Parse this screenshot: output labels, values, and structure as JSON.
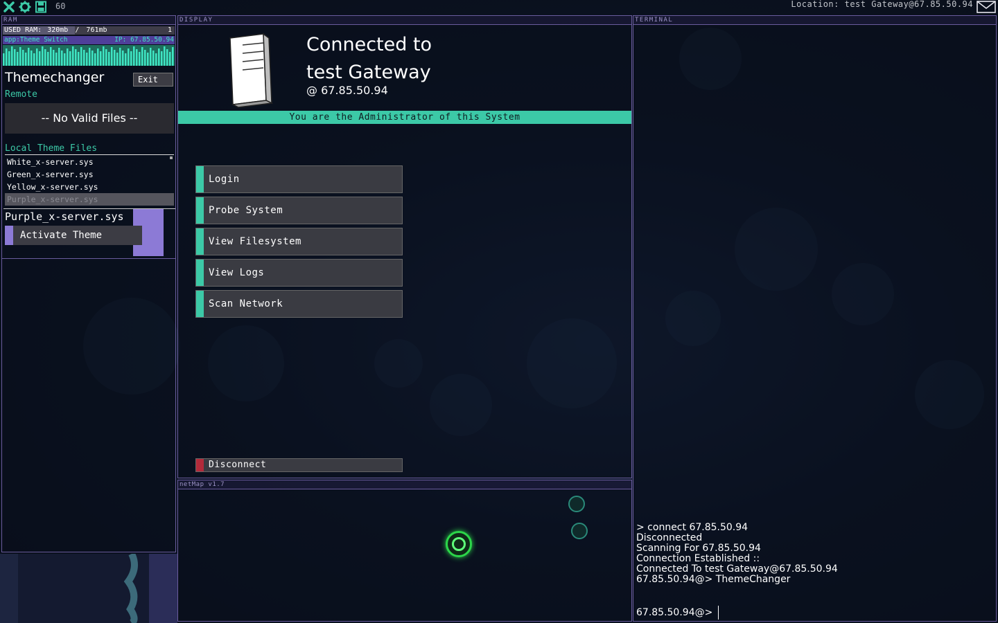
{
  "topbar": {
    "icons": [
      "close-icon",
      "gear-icon",
      "save-icon"
    ],
    "fps": "60",
    "location": "Location: test Gateway@67.85.50.94",
    "mail_icon": "mail-icon"
  },
  "ram": {
    "header": "RAM",
    "used_label": "USED RAM:",
    "used_value": "320mb",
    "total": "761mb",
    "separator": "/",
    "count": "1",
    "used_fraction": 0.42,
    "app_label": "app:Theme Switch",
    "app_ip": "IP: 67.85.50.94"
  },
  "themechanger": {
    "title": "Themechanger",
    "exit_label": "Exit",
    "remote_label": "Remote",
    "no_files": "-- No Valid Files --",
    "local_label": "Local Theme Files",
    "files": [
      "White_x-server.sys",
      "Green_x-server.sys",
      "Yellow_x-server.sys",
      "Purple_x-server.sys"
    ],
    "selected_file": "Purple_x-server.sys",
    "activate_label": "Activate Theme",
    "swatch_color": "#8c7ad6"
  },
  "display": {
    "header": "DISPLAY",
    "title_line1": "Connected to",
    "title_line2": "test Gateway",
    "ip_line": "@  67.85.50.94",
    "admin_banner": "You are the Administrator of this System",
    "menu": [
      "Login",
      "Probe System",
      "View Filesystem",
      "View Logs",
      "Scan Network"
    ],
    "disconnect_label": "Disconnect",
    "accent_color": "#3cc9a7",
    "danger_color": "#b22a3a"
  },
  "netmap": {
    "header": "netMap v1.7"
  },
  "terminal": {
    "header": "TERMINAL",
    "history": [
      "> connect 67.85.50.94",
      "Disconnected",
      "Scanning For 67.85.50.94",
      "Connection Established ::",
      "Connected To test Gateway@67.85.50.94",
      "67.85.50.94@> ThemeChanger"
    ],
    "prompt": "67.85.50.94@>"
  }
}
